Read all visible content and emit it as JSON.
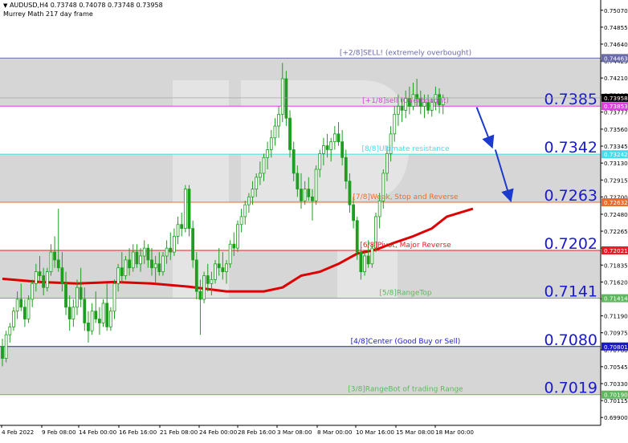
{
  "header": {
    "symbol_line": "AUDUSD,H4  0.73748 0.74078 0.73748 0.73958",
    "indicator_name": "Murrey Math 217 day frame"
  },
  "chart_data": {
    "type": "candlestick",
    "symbol": "AUDUSD",
    "timeframe": "H4",
    "y_range": [
      0.698,
      0.752
    ],
    "y_axis_ticks": [
      "0.75070",
      "0.74855",
      "0.74640",
      "0.74425",
      "0.74210",
      "0.73995",
      "0.73777",
      "0.73560",
      "0.73345",
      "0.73130",
      "0.72915",
      "0.72700",
      "0.72480",
      "0.72265",
      "0.72050",
      "0.71835",
      "0.71620",
      "0.71405",
      "0.71190",
      "0.70975",
      "0.70760",
      "0.70545",
      "0.70330",
      "0.70115",
      "0.69900"
    ],
    "x_axis_ticks": [
      "4 Feb 2022",
      "9 Feb 08:00",
      "14 Feb 00:00",
      "16 Feb 16:00",
      "21 Feb 08:00",
      "24 Feb 00:00",
      "28 Feb 16:00",
      "3 Mar 08:00",
      "8 Mar 00:00",
      "10 Mar 16:00",
      "15 Mar 08:00",
      "18 Mar 00:00"
    ],
    "current_price": "0.73958",
    "bands": [
      {
        "from": 0.74463,
        "to": 0.73853,
        "color": "#d6d6d6"
      },
      {
        "from": 0.73242,
        "to": 0.72632,
        "color": "#d6d6d6"
      },
      {
        "from": 0.72021,
        "to": 0.71414,
        "color": "#d6d6d6"
      },
      {
        "from": 0.70801,
        "to": 0.7019,
        "color": "#d6d6d6"
      }
    ],
    "murrey_levels": [
      {
        "price": 0.74463,
        "tag": "0.74463",
        "color": "#6a6aaa",
        "label": "[+2/8]SELL! (extremely overbought)",
        "big": ""
      },
      {
        "price": 0.73853,
        "tag": "0.73853",
        "color": "#e23ce2",
        "label": "[+1/8]sell (Overbought)",
        "big": "0.7385"
      },
      {
        "price": 0.73242,
        "tag": "0.73242",
        "color": "#3ee0f0",
        "label": "[8/8]Ultimate resistance",
        "big": "0.7342"
      },
      {
        "price": 0.72632,
        "tag": "0.72632",
        "color": "#ee6a2a",
        "label": "[7/8]Weak, Stop and Reverse",
        "big": "0.7263"
      },
      {
        "price": 0.72021,
        "tag": "0.72021",
        "color": "#ee1c1c",
        "label": "[6/8]Pivot, Major Reverse",
        "big": "0.7202"
      },
      {
        "price": 0.71414,
        "tag": "0.71414",
        "color": "#5cb85c",
        "label": "[5/8]RangeTop",
        "big": "0.7141"
      },
      {
        "price": 0.70801,
        "tag": "0.70801",
        "color": "#1a1acc",
        "label": "[4/8]Center (Good Buy or Sell)",
        "big": "0.7080"
      },
      {
        "price": 0.7019,
        "tag": "0.70190",
        "color": "#5cb85c",
        "label": "[3/8]RangeBot of trading Range",
        "big": "0.7019"
      }
    ],
    "moving_average": {
      "color": "#dd0000",
      "points": [
        [
          0,
          0.7166
        ],
        [
          10,
          0.7162
        ],
        [
          20,
          0.716
        ],
        [
          30,
          0.7162
        ],
        [
          40,
          0.716
        ],
        [
          50,
          0.7156
        ],
        [
          60,
          0.715
        ],
        [
          70,
          0.715
        ],
        [
          75,
          0.7155
        ],
        [
          80,
          0.717
        ],
        [
          85,
          0.7175
        ],
        [
          90,
          0.7185
        ],
        [
          95,
          0.7198
        ],
        [
          100,
          0.7203
        ],
        [
          105,
          0.7212
        ],
        [
          110,
          0.722
        ],
        [
          115,
          0.723
        ],
        [
          119,
          0.7245
        ],
        [
          126,
          0.7255
        ]
      ]
    },
    "forecast_arrows": [
      {
        "from": [
          127,
          0.7384
        ],
        "to": [
          131,
          0.7335
        ]
      },
      {
        "from": [
          132,
          0.733
        ],
        "to": [
          136,
          0.7267
        ]
      }
    ],
    "candles": [
      [
        0,
        0.708,
        0.709,
        0.7055,
        0.7065
      ],
      [
        1,
        0.7065,
        0.71,
        0.706,
        0.7095
      ],
      [
        2,
        0.7095,
        0.711,
        0.7085,
        0.7105
      ],
      [
        3,
        0.7105,
        0.713,
        0.71,
        0.7125
      ],
      [
        4,
        0.7125,
        0.715,
        0.7115,
        0.714
      ],
      [
        5,
        0.714,
        0.716,
        0.7125,
        0.713
      ],
      [
        6,
        0.713,
        0.714,
        0.7105,
        0.7115
      ],
      [
        7,
        0.7115,
        0.7145,
        0.711,
        0.714
      ],
      [
        8,
        0.714,
        0.7165,
        0.713,
        0.716
      ],
      [
        9,
        0.716,
        0.7185,
        0.715,
        0.7175
      ],
      [
        10,
        0.7175,
        0.7195,
        0.716,
        0.717
      ],
      [
        11,
        0.717,
        0.718,
        0.7145,
        0.7155
      ],
      [
        12,
        0.7155,
        0.718,
        0.715,
        0.7175
      ],
      [
        13,
        0.7175,
        0.721,
        0.717,
        0.72
      ],
      [
        14,
        0.72,
        0.722,
        0.718,
        0.719
      ],
      [
        15,
        0.719,
        0.7255,
        0.7175,
        0.718
      ],
      [
        16,
        0.718,
        0.72,
        0.715,
        0.716
      ],
      [
        17,
        0.716,
        0.7175,
        0.712,
        0.713
      ],
      [
        18,
        0.713,
        0.7145,
        0.71,
        0.7115
      ],
      [
        19,
        0.7115,
        0.714,
        0.7105,
        0.713
      ],
      [
        20,
        0.713,
        0.7165,
        0.712,
        0.7155
      ],
      [
        21,
        0.7155,
        0.718,
        0.713,
        0.714
      ],
      [
        22,
        0.714,
        0.7155,
        0.71,
        0.711
      ],
      [
        23,
        0.711,
        0.7125,
        0.7085,
        0.71
      ],
      [
        24,
        0.71,
        0.7135,
        0.7095,
        0.7125
      ],
      [
        25,
        0.7125,
        0.715,
        0.711,
        0.7115
      ],
      [
        26,
        0.7115,
        0.713,
        0.7095,
        0.711
      ],
      [
        27,
        0.711,
        0.714,
        0.7105,
        0.7135
      ],
      [
        28,
        0.7135,
        0.716,
        0.71,
        0.7105
      ],
      [
        29,
        0.7105,
        0.713,
        0.71,
        0.7125
      ],
      [
        30,
        0.7125,
        0.7165,
        0.7115,
        0.716
      ],
      [
        31,
        0.716,
        0.7185,
        0.715,
        0.718
      ],
      [
        32,
        0.718,
        0.72,
        0.716,
        0.717
      ],
      [
        33,
        0.717,
        0.7195,
        0.7165,
        0.719
      ],
      [
        34,
        0.719,
        0.7205,
        0.717,
        0.718
      ],
      [
        35,
        0.718,
        0.721,
        0.7175,
        0.72
      ],
      [
        36,
        0.72,
        0.721,
        0.718,
        0.7185
      ],
      [
        37,
        0.7185,
        0.7205,
        0.7175,
        0.7195
      ],
      [
        38,
        0.7195,
        0.7215,
        0.7185,
        0.7205
      ],
      [
        39,
        0.7205,
        0.721,
        0.718,
        0.719
      ],
      [
        40,
        0.719,
        0.7205,
        0.717,
        0.718
      ],
      [
        41,
        0.718,
        0.7195,
        0.716,
        0.7185
      ],
      [
        42,
        0.7185,
        0.72,
        0.717,
        0.7175
      ],
      [
        43,
        0.7175,
        0.72,
        0.717,
        0.7195
      ],
      [
        44,
        0.7195,
        0.7215,
        0.7185,
        0.7205
      ],
      [
        45,
        0.7205,
        0.7225,
        0.719,
        0.72
      ],
      [
        46,
        0.72,
        0.723,
        0.7195,
        0.722
      ],
      [
        47,
        0.722,
        0.7245,
        0.721,
        0.7235
      ],
      [
        48,
        0.7235,
        0.725,
        0.722,
        0.723
      ],
      [
        49,
        0.723,
        0.7285,
        0.7225,
        0.728
      ],
      [
        50,
        0.728,
        0.7285,
        0.722,
        0.723
      ],
      [
        51,
        0.723,
        0.724,
        0.718,
        0.719
      ],
      [
        52,
        0.719,
        0.72,
        0.714,
        0.715
      ],
      [
        53,
        0.715,
        0.7165,
        0.7095,
        0.714
      ],
      [
        54,
        0.714,
        0.7175,
        0.7135,
        0.717
      ],
      [
        55,
        0.717,
        0.7185,
        0.715,
        0.716
      ],
      [
        56,
        0.716,
        0.7175,
        0.7145,
        0.7165
      ],
      [
        57,
        0.7165,
        0.719,
        0.716,
        0.7185
      ],
      [
        58,
        0.7185,
        0.7205,
        0.717,
        0.718
      ],
      [
        59,
        0.718,
        0.72,
        0.7165,
        0.7175
      ],
      [
        60,
        0.7175,
        0.719,
        0.716,
        0.7185
      ],
      [
        61,
        0.7185,
        0.7215,
        0.718,
        0.721
      ],
      [
        62,
        0.721,
        0.7225,
        0.7195,
        0.7205
      ],
      [
        63,
        0.7205,
        0.724,
        0.72,
        0.7235
      ],
      [
        64,
        0.7235,
        0.7255,
        0.7225,
        0.7245
      ],
      [
        65,
        0.7245,
        0.7265,
        0.7235,
        0.726
      ],
      [
        66,
        0.726,
        0.7275,
        0.725,
        0.727
      ],
      [
        67,
        0.727,
        0.729,
        0.726,
        0.728
      ],
      [
        68,
        0.728,
        0.73,
        0.727,
        0.7295
      ],
      [
        69,
        0.7295,
        0.7315,
        0.7285,
        0.73
      ],
      [
        70,
        0.73,
        0.7325,
        0.729,
        0.732
      ],
      [
        71,
        0.732,
        0.734,
        0.7305,
        0.733
      ],
      [
        72,
        0.733,
        0.7355,
        0.732,
        0.7345
      ],
      [
        73,
        0.7345,
        0.737,
        0.7335,
        0.736
      ],
      [
        74,
        0.736,
        0.7385,
        0.7345,
        0.7375
      ],
      [
        75,
        0.7375,
        0.744,
        0.7365,
        0.742
      ],
      [
        76,
        0.742,
        0.743,
        0.736,
        0.737
      ],
      [
        77,
        0.737,
        0.738,
        0.732,
        0.733
      ],
      [
        78,
        0.733,
        0.734,
        0.729,
        0.73
      ],
      [
        79,
        0.73,
        0.731,
        0.727,
        0.728
      ],
      [
        80,
        0.728,
        0.73,
        0.7255,
        0.7265
      ],
      [
        81,
        0.7265,
        0.729,
        0.726,
        0.728
      ],
      [
        82,
        0.728,
        0.7295,
        0.7265,
        0.727
      ],
      [
        83,
        0.727,
        0.728,
        0.724,
        0.7265
      ],
      [
        84,
        0.7265,
        0.731,
        0.726,
        0.7305
      ],
      [
        85,
        0.7305,
        0.733,
        0.7295,
        0.7325
      ],
      [
        86,
        0.7325,
        0.7345,
        0.731,
        0.7335
      ],
      [
        87,
        0.7335,
        0.735,
        0.732,
        0.733
      ],
      [
        88,
        0.733,
        0.7345,
        0.7315,
        0.734
      ],
      [
        89,
        0.734,
        0.736,
        0.733,
        0.735
      ],
      [
        90,
        0.735,
        0.7365,
        0.7335,
        0.734
      ],
      [
        91,
        0.734,
        0.7355,
        0.731,
        0.732
      ],
      [
        92,
        0.732,
        0.733,
        0.728,
        0.729
      ],
      [
        93,
        0.729,
        0.73,
        0.725,
        0.726
      ],
      [
        94,
        0.726,
        0.727,
        0.723,
        0.724
      ],
      [
        95,
        0.724,
        0.7245,
        0.719,
        0.72
      ],
      [
        96,
        0.72,
        0.7205,
        0.7165,
        0.7175
      ],
      [
        97,
        0.7175,
        0.72,
        0.717,
        0.7195
      ],
      [
        98,
        0.7195,
        0.7215,
        0.718,
        0.7185
      ],
      [
        99,
        0.7185,
        0.721,
        0.718,
        0.7205
      ],
      [
        100,
        0.7205,
        0.725,
        0.72,
        0.7245
      ],
      [
        101,
        0.7245,
        0.7275,
        0.723,
        0.7265
      ],
      [
        102,
        0.7265,
        0.7305,
        0.7255,
        0.73
      ],
      [
        103,
        0.73,
        0.7335,
        0.729,
        0.7325
      ],
      [
        104,
        0.7325,
        0.736,
        0.7315,
        0.735
      ],
      [
        105,
        0.735,
        0.7385,
        0.734,
        0.7375
      ],
      [
        106,
        0.7375,
        0.74,
        0.736,
        0.7385
      ],
      [
        107,
        0.7385,
        0.7395,
        0.7365,
        0.738
      ],
      [
        108,
        0.738,
        0.7405,
        0.737,
        0.7395
      ],
      [
        109,
        0.7395,
        0.741,
        0.7375,
        0.7385
      ],
      [
        110,
        0.7385,
        0.7415,
        0.738,
        0.74
      ],
      [
        111,
        0.74,
        0.742,
        0.7385,
        0.7395
      ],
      [
        112,
        0.7395,
        0.7405,
        0.7375,
        0.7385
      ],
      [
        113,
        0.7385,
        0.74,
        0.737,
        0.739
      ],
      [
        114,
        0.739,
        0.74,
        0.7375,
        0.738
      ],
      [
        115,
        0.738,
        0.7395,
        0.7372,
        0.739
      ],
      [
        116,
        0.739,
        0.741,
        0.738,
        0.74
      ],
      [
        117,
        0.74,
        0.7408,
        0.7376,
        0.7387
      ],
      [
        118,
        0.7387,
        0.74,
        0.7375,
        0.7396
      ]
    ]
  }
}
